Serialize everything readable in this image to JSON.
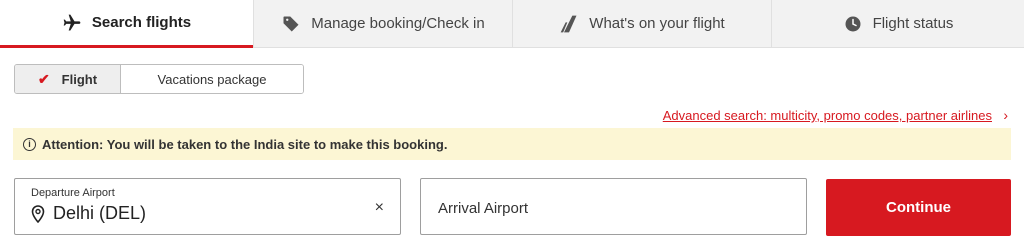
{
  "tabs": [
    {
      "label": "Search flights",
      "icon": "airplane-icon",
      "active": true
    },
    {
      "label": "Manage booking/Check in",
      "icon": "tag-icon",
      "active": false
    },
    {
      "label": "What's on your flight",
      "icon": "tail-fin-icon",
      "active": false
    },
    {
      "label": "Flight status",
      "icon": "clock-icon",
      "active": false
    }
  ],
  "trip_type": {
    "options": [
      "Flight",
      "Vacations package"
    ],
    "selected": "Flight"
  },
  "advanced_link": "Advanced search: multicity, promo codes, partner airlines",
  "banner": {
    "text": "Attention: You will be taken to the India site to make this booking."
  },
  "departure": {
    "label": "Departure Airport",
    "value": "Delhi (DEL)"
  },
  "arrival": {
    "placeholder": "Arrival Airport"
  },
  "continue_label": "Continue",
  "colors": {
    "accent": "#d71920",
    "banner_bg": "#fcf6d4",
    "tab_bg": "#f2f2f2"
  }
}
